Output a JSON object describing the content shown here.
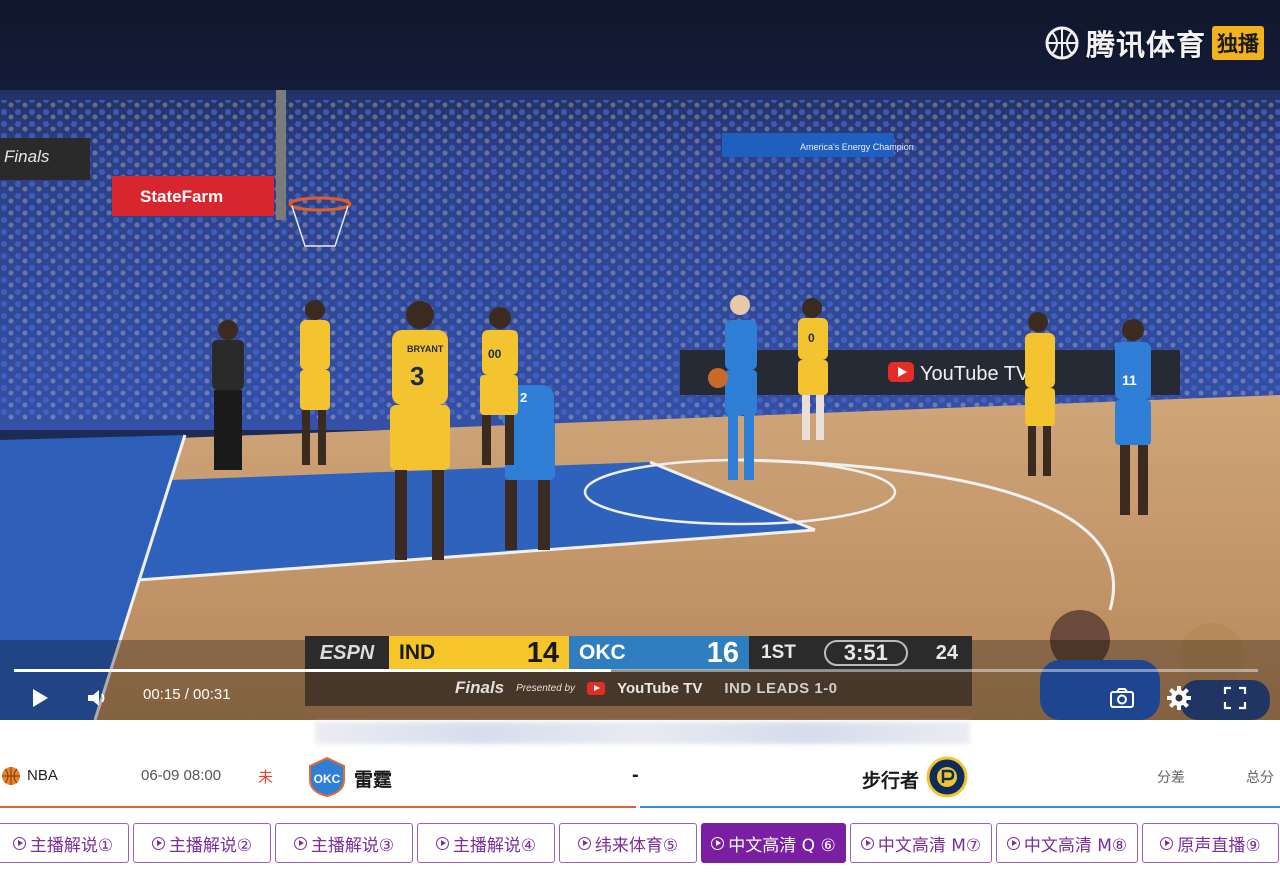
{
  "watermark": {
    "brand": "腾讯体育",
    "badge": "独播"
  },
  "scorebug": {
    "network": "ESPN",
    "team1": {
      "abbr": "IND",
      "score": "14"
    },
    "team2": {
      "abbr": "OKC",
      "score": "16"
    },
    "period": "1ST",
    "clock": "3:51",
    "shot_clock": "24",
    "finals": "Finals",
    "presented_by": "Presented by",
    "sponsor": "YouTube TV",
    "series_status": "IND LEADS 1-0"
  },
  "arena_signs": {
    "statefarm": "StateFarm",
    "finals": "Finals",
    "youtube_tv": "YouTube TV",
    "banner": "America's Energy Champion",
    "jersey_bryant": "BRYANT",
    "jersey_3": "3",
    "jersey_00": "00",
    "jersey_2": "2",
    "jersey_0": "0",
    "jersey_11": "11"
  },
  "player": {
    "elapsed": "00:15",
    "duration": "00:31",
    "time_display": "00:15 / 00:31",
    "progress": 0.48
  },
  "game": {
    "league": "NBA",
    "datetime": "06-09 08:00",
    "status": "未",
    "home_team": "雷霆",
    "home_logo": "OKC",
    "separator": "-",
    "away_team": "步行者",
    "spread_label": "分差",
    "total_label": "总分",
    "colors": {
      "home": "#e0603c",
      "away": "#3a8ad8"
    }
  },
  "streams": [
    {
      "label": "主播解说①",
      "active": false
    },
    {
      "label": "主播解说②",
      "active": false
    },
    {
      "label": "主播解说③",
      "active": false
    },
    {
      "label": "主播解说④",
      "active": false
    },
    {
      "label": "纬来体育⑤",
      "active": false
    },
    {
      "label": "中文高清 Q ⑥",
      "active": true
    },
    {
      "label": "中文高清 M⑦",
      "active": false
    },
    {
      "label": "中文高清 M⑧",
      "active": false
    },
    {
      "label": "原声直播⑨",
      "active": false
    }
  ],
  "accent_color": "#7b1fa2"
}
